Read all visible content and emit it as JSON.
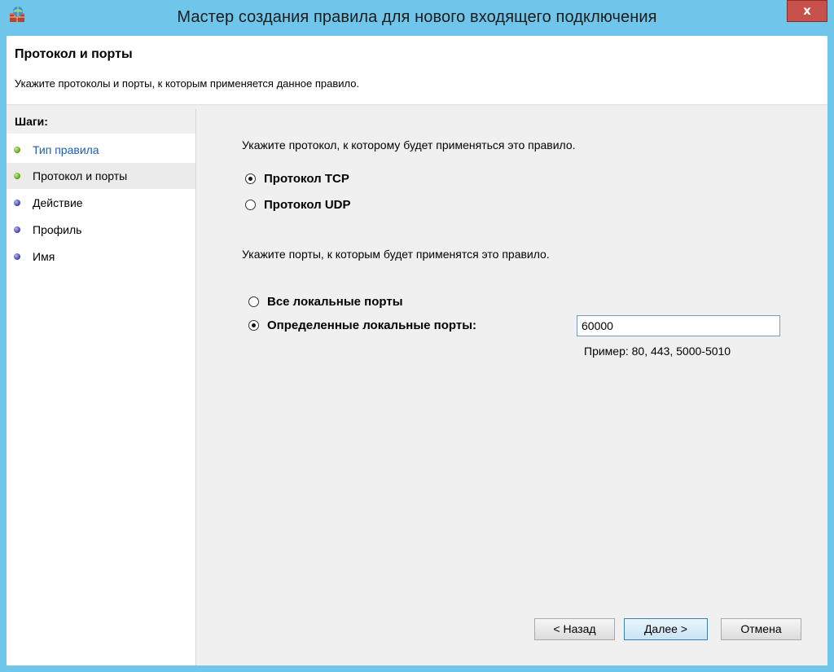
{
  "window": {
    "title": "Мастер создания правила для нового входящего подключения",
    "close_label": "x"
  },
  "header": {
    "title": "Протокол и порты",
    "subtitle": "Укажите протоколы и порты, к которым применяется данное правило."
  },
  "steps": {
    "title": "Шаги:",
    "items": [
      {
        "label": "Тип правила",
        "status": "done"
      },
      {
        "label": "Протокол и порты",
        "status": "current"
      },
      {
        "label": "Действие",
        "status": "pending"
      },
      {
        "label": "Профиль",
        "status": "pending"
      },
      {
        "label": "Имя",
        "status": "pending"
      }
    ]
  },
  "protocol": {
    "prompt": "Укажите протокол, к которому будет применяться это правило.",
    "tcp_label": "Протокол TCP",
    "udp_label": "Протокол UDP",
    "selected": "tcp"
  },
  "ports": {
    "prompt": "Укажите порты, к которым будет применятся это правило.",
    "all_label": "Все локальные порты",
    "specific_label": "Определенные локальные порты:",
    "selected": "specific",
    "value": "60000",
    "example": "Пример: 80, 443, 5000-5010"
  },
  "buttons": {
    "back": "< Назад",
    "next": "Далее >",
    "cancel": "Отмена"
  },
  "colors": {
    "frame": "#6fc6ea",
    "close": "#c7504a",
    "step_done": "#5a9e1a",
    "step_pending": "#3a3aa8",
    "link": "#1a5fb4"
  }
}
